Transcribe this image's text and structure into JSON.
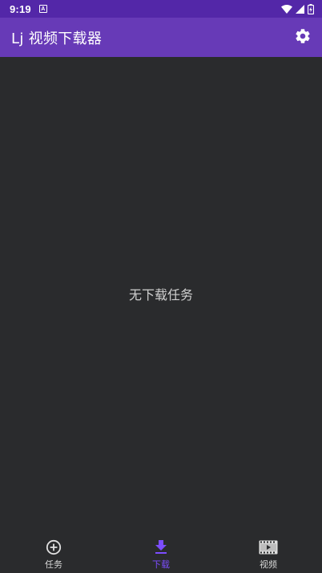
{
  "status_bar": {
    "time": "9:19",
    "notification_letter": "A"
  },
  "app_bar": {
    "title": "Lj 视频下载器"
  },
  "content": {
    "empty_message": "无下载任务"
  },
  "bottom_nav": {
    "items": [
      {
        "label": "任务",
        "icon": "add-circle-icon",
        "active": false
      },
      {
        "label": "下载",
        "icon": "download-icon",
        "active": true
      },
      {
        "label": "视频",
        "icon": "video-film-icon",
        "active": false
      }
    ]
  },
  "colors": {
    "status_bar": "#5327a8",
    "app_bar": "#673ab7",
    "background": "#2a2b2d",
    "active_tab": "#7c4dff",
    "inactive_tab": "#d8d8d8"
  }
}
